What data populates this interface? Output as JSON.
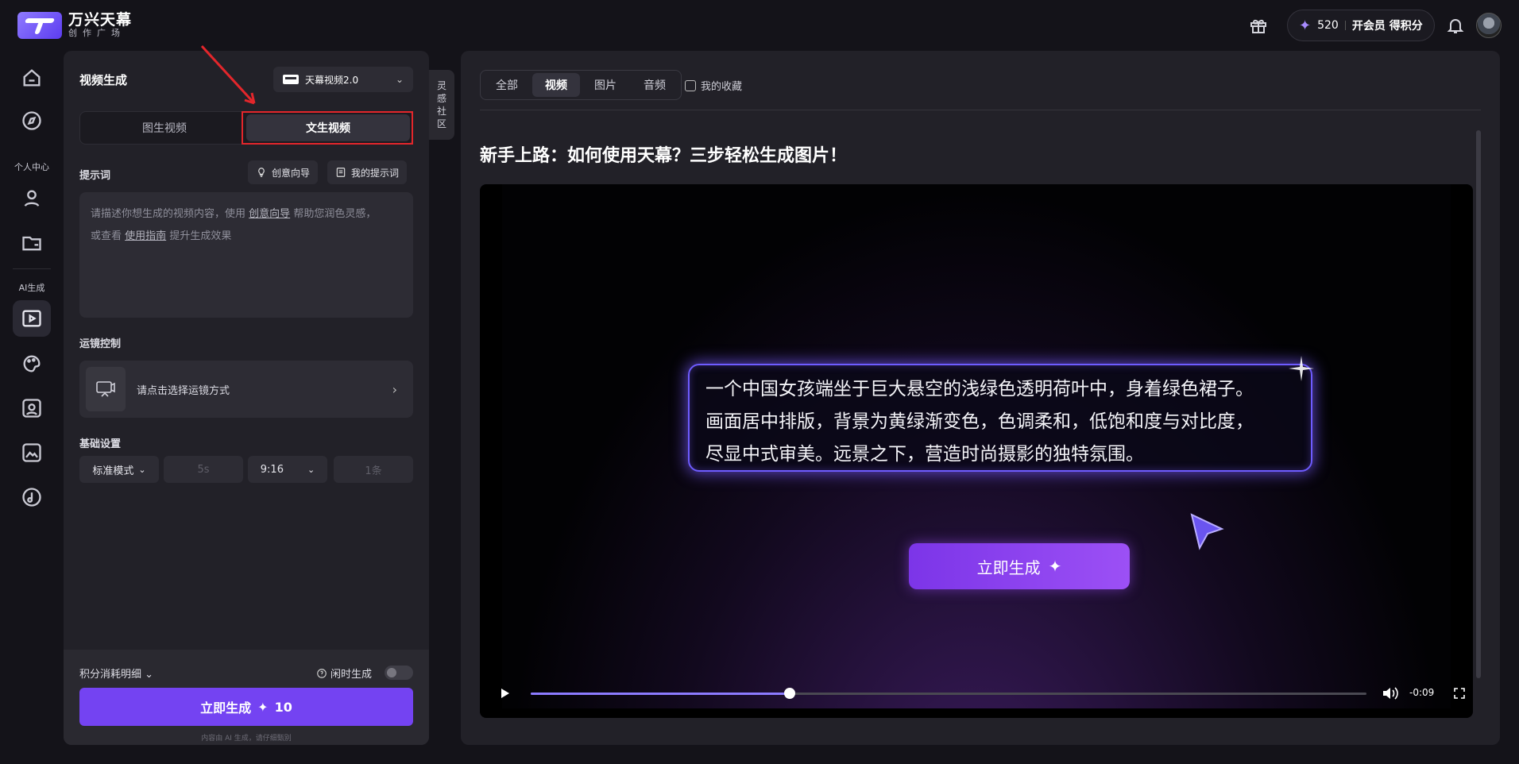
{
  "brand": {
    "name": "万兴天幕",
    "sub": "创作广场"
  },
  "header": {
    "points": "520",
    "vip_label": "开会员 得积分",
    "icons": [
      "gift-icon",
      "sparkle-icon",
      "bell-icon",
      "avatar"
    ]
  },
  "rail": {
    "label_personal": "个人中心",
    "label_ai": "AI生成",
    "icons": [
      "home-icon",
      "explore-icon",
      "user-icon",
      "folder-icon",
      "video-gen-icon",
      "image-gen-icon",
      "image-edit-icon",
      "photo-icon",
      "audio-icon"
    ]
  },
  "panel": {
    "title": "视频生成",
    "model": "天幕视频2.0",
    "tabs": [
      "图生视频",
      "文生视频"
    ],
    "active_tab": "文生视频",
    "prompt_label": "提示词",
    "btn_wizard": "创意向导",
    "btn_my_prompts": "我的提示词",
    "placeholder_1": "请描述你想生成的视频内容，使用",
    "placeholder_link1": "创意向导",
    "placeholder_2": "帮助您润色灵感，",
    "placeholder_3": "或查看",
    "placeholder_link2": "使用指南",
    "placeholder_4": "提升生成效果",
    "camera_label": "运镜控制",
    "camera_text": "请点击选择运镜方式",
    "basic_label": "基础设置",
    "opt_mode": "标准模式",
    "opt_duration": "5s",
    "opt_ratio": "9:16",
    "opt_count": "1条",
    "cost_label": "积分消耗明细",
    "idle_label": "闲时生成",
    "idle_on": false,
    "generate_label": "立即生成",
    "generate_cost": "10",
    "note": "内容由 AI 生成，请仔细甄别"
  },
  "community_tab": [
    "灵",
    "感",
    "社",
    "区"
  ],
  "main": {
    "filters": [
      "全部",
      "视频",
      "图片",
      "音频"
    ],
    "active_filter": "视频",
    "favorites_label": "我的收藏",
    "guide_title": "新手上路：如何使用天幕？三步轻松生成图片！",
    "video": {
      "prompt_lines": [
        "一个中国女孩端坐于巨大悬空的浅绿色透明荷叶中，身着绿色裙子。",
        "画面居中排版，背景为黄绿渐变色，色调柔和，低饱和度与对比度，",
        "尽显中式审美。远景之下，营造时尚摄影的独特氛围。"
      ],
      "button_label": "立即生成",
      "time": "-0:09",
      "progress": 0.31
    }
  },
  "colors": {
    "accent": "#7443f2",
    "highlight": "#e3262b"
  }
}
